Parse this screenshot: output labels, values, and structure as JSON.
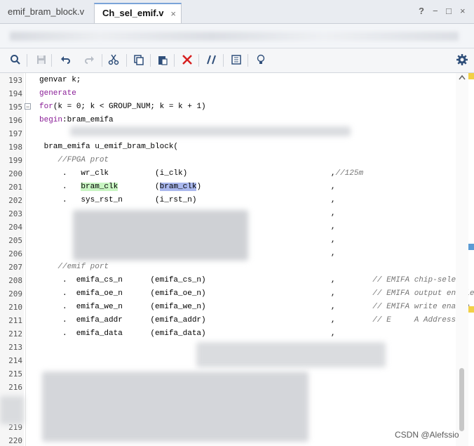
{
  "tabs": [
    {
      "label": "emif_bram_block.v",
      "active": false
    },
    {
      "label": "Ch_sel_emif.v",
      "active": true
    }
  ],
  "tab_close_glyph": "×",
  "window_controls": {
    "help": "?",
    "minimize": "−",
    "restore": "□",
    "close": "×"
  },
  "toolbar_icons": [
    "search-icon",
    "save-icon",
    "undo-icon",
    "redo-icon",
    "cut-icon",
    "copy-icon",
    "paste-icon",
    "delete-icon",
    "comment-toggle-icon",
    "column-select-icon",
    "lightbulb-icon",
    "settings-icon"
  ],
  "colors": {
    "keyword": "#8a1d97",
    "comment": "#757575",
    "highlight_green": "#c8f5c2",
    "highlight_blue": "#aab8ee",
    "marker_yellow": "#f2d046",
    "marker_blue": "#5b9bd5"
  },
  "lines": [
    {
      "n": "193",
      "segs": [
        {
          "t": "genvar k;"
        }
      ]
    },
    {
      "n": "194",
      "segs": [
        {
          "t": "generate",
          "c": "kw"
        }
      ]
    },
    {
      "n": "195",
      "segs": [
        {
          "t": "for",
          "c": "kw"
        },
        {
          "t": "(k = 0; k < GROUP_NUM; k = k + 1)"
        }
      ]
    },
    {
      "n": "196",
      "segs": [
        {
          "t": "begin",
          "c": "kw"
        },
        {
          "t": ":bram_emifa"
        }
      ]
    },
    {
      "n": "197",
      "segs": []
    },
    {
      "n": "198",
      "segs": [
        {
          "t": " bram_emifa u_emif_bram_block("
        }
      ]
    },
    {
      "n": "199",
      "segs": [
        {
          "t": "    //FPGA prot",
          "c": "cm"
        }
      ]
    },
    {
      "n": "200",
      "segs": [
        {
          "t": "     .   wr_clk          (i_clk)                               ,"
        },
        {
          "t": "//125m",
          "c": "cm"
        }
      ]
    },
    {
      "n": "201",
      "segs": [
        {
          "t": "     .   "
        },
        {
          "t": "bram_clk",
          "c": "hl-g"
        },
        {
          "t": "        ("
        },
        {
          "t": "bram_clk",
          "c": "hl-b"
        },
        {
          "t": ")                            ,"
        }
      ]
    },
    {
      "n": "202",
      "segs": [
        {
          "t": "     .   sys_rst_n       (i_rst_n)                             ,"
        }
      ]
    },
    {
      "n": "203",
      "segs": [
        {
          "t": "                                                               ,"
        }
      ]
    },
    {
      "n": "204",
      "segs": [
        {
          "t": "                                                               ,"
        }
      ]
    },
    {
      "n": "205",
      "segs": [
        {
          "t": "                                                               ,"
        }
      ]
    },
    {
      "n": "206",
      "segs": [
        {
          "t": "                                                               ,"
        }
      ]
    },
    {
      "n": "207",
      "segs": [
        {
          "t": "    //emif port",
          "c": "cm"
        }
      ]
    },
    {
      "n": "208",
      "segs": [
        {
          "t": "     .  emifa_cs_n      (emifa_cs_n)                           ,        "
        },
        {
          "t": "// EMIFA chip-select, ac",
          "c": "cm"
        }
      ]
    },
    {
      "n": "209",
      "segs": [
        {
          "t": "     .  emifa_oe_n      (emifa_oe_n)                           ,        "
        },
        {
          "t": "// EMIFA output enable,",
          "c": "cm"
        }
      ]
    },
    {
      "n": "210",
      "segs": [
        {
          "t": "     .  emifa_we_n      (emifa_we_n)                           ,        "
        },
        {
          "t": "// EMIFA write enable, a",
          "c": "cm"
        }
      ]
    },
    {
      "n": "211",
      "segs": [
        {
          "t": "     .  emifa_addr      (emifa_addr)                           ,        "
        },
        {
          "t": "// E",
          "c": "cm"
        },
        {
          "t": "     ",
          "c": "cm"
        },
        {
          "t": "A Address",
          "c": "cm"
        }
      ]
    },
    {
      "n": "212",
      "segs": [
        {
          "t": "     .  emifa_data      (emifa_data)                           ,"
        }
      ]
    },
    {
      "n": "213",
      "segs": []
    },
    {
      "n": "214",
      "segs": []
    },
    {
      "n": "215",
      "segs": []
    },
    {
      "n": "216",
      "segs": []
    },
    {
      "n": "",
      "segs": []
    },
    {
      "n": "",
      "segs": []
    },
    {
      "n": "219",
      "segs": []
    },
    {
      "n": "220",
      "segs": []
    }
  ],
  "watermark": "CSDN @Alefssio"
}
